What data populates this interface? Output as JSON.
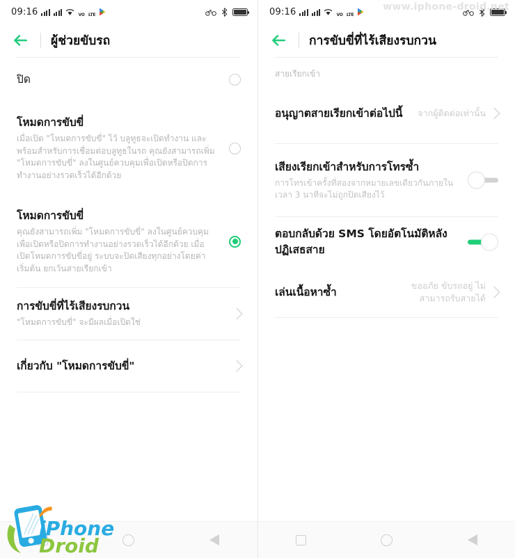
{
  "watermark": "www.iphone-droid.net",
  "status_bar": {
    "time": "09:16",
    "network_label": "VO",
    "network_label2": "LTE",
    "icons": [
      "signal-bars",
      "signal-bars",
      "wifi-icon",
      "volte-icon",
      "play-store-icon",
      "bicycle-icon",
      "bluetooth-icon",
      "battery-icon"
    ]
  },
  "left_screen": {
    "title": "ผู้ช่วยขับรถ",
    "back_label": "back-arrow",
    "options": [
      {
        "title": "ปิด",
        "desc": "",
        "selected": false
      },
      {
        "title": "โหมดการขับขี่",
        "desc": "เมื่อเปิด \"โหมดการขับขี่\" ไว้ บลูทูธจะเปิดทำงาน และพร้อมสำหรับการเชื่อมต่อบลูทูธในรถ คุณยังสามารถเพิ่ม \"โหมดการขับขี่\" ลงในศูนย์ควบคุมเพื่อเปิดหรือปิดการทำงานอย่างรวดเร็วได้อีกด้วย",
        "selected": false
      },
      {
        "title": "โหมดการขับขี่",
        "desc": "คุณยังสามารถเพิ่ม \"โหมดการขับขี่\" ลงในศูนย์ควบคุมเพื่อเปิดหรือปิดการทำงานอย่างรวดเร็วได้อีกด้วย เมื่อเปิดโหมดการขับขี่อยู่ ระบบจะปิดเสียงทุกอย่างโดยค่าเริ่มต้น ยกเว้นสายเรียกเข้า",
        "selected": true
      }
    ],
    "links": [
      {
        "title": "การขับขี่ที่ไร้เสียงรบกวน",
        "desc": "\"โหมดการขับขี่\" จะมีผลเมื่อเปิดใช่"
      },
      {
        "title": "เกี่ยวกับ \"โหมดการขับขี่\"",
        "desc": ""
      }
    ]
  },
  "right_screen": {
    "title": "การขับขี่ที่ไร้เสียงรบกวน",
    "section_label": "สายเรียกเข้า",
    "rows": [
      {
        "title": "อนุญาตสายเรียกเข้าต่อไปนี้",
        "sub": "",
        "value": "จากผู้ติดต่อเท่านั้น",
        "control": "chevron"
      },
      {
        "title": "เสียงเรียกเข้าสำหรับการโทรซ้ำ",
        "sub": "การโทรเข้าครั้งที่สองจากหมายเลขเดียวกันภายในเวลา 3 นาทีจะไม่ถูกปิดเสียงไว้",
        "value": "",
        "control": "switch-off"
      },
      {
        "title": "ตอบกลับด้วย SMS โดยอัตโนมัติหลังปฏิเสธสาย",
        "sub": "",
        "value": "",
        "control": "switch-on"
      },
      {
        "title": "เล่นเนื้อหาซ้ำ",
        "sub": "",
        "value": "ขออภัย ขับรถอยู่ ไม่สามารถรับสายได้",
        "control": "chevron"
      }
    ]
  },
  "nav_bar": {
    "recent_label": "recent-apps-button",
    "home_label": "home-button",
    "back_label": "back-button"
  },
  "logo": {
    "line1": "iPhone",
    "line2": "Droid"
  },
  "colors": {
    "accent_green": "#1fce78",
    "title_text": "#171717",
    "secondary_text": "#bcbcbc",
    "divider": "#ededed"
  }
}
